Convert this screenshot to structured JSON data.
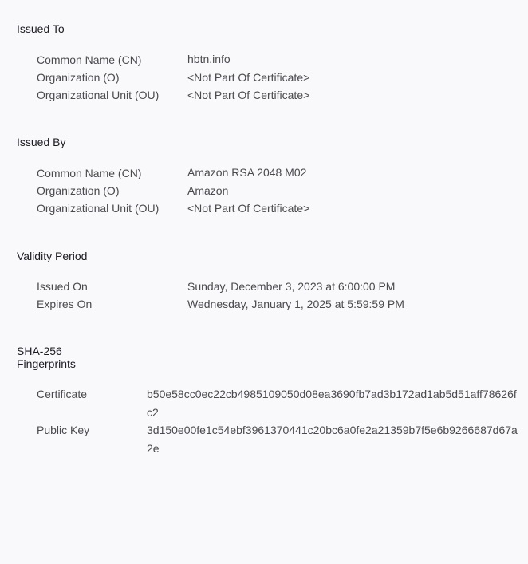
{
  "issued_to": {
    "heading": "Issued To",
    "rows": [
      {
        "label": "Common Name (CN)",
        "value": "hbtn.info"
      },
      {
        "label": "Organization (O)",
        "value": "<Not Part Of Certificate>"
      },
      {
        "label": "Organizational Unit (OU)",
        "value": "<Not Part Of Certificate>"
      }
    ]
  },
  "issued_by": {
    "heading": "Issued By",
    "rows": [
      {
        "label": "Common Name (CN)",
        "value": "Amazon RSA 2048 M02"
      },
      {
        "label": "Organization (O)",
        "value": "Amazon"
      },
      {
        "label": "Organizational Unit (OU)",
        "value": "<Not Part Of Certificate>"
      }
    ]
  },
  "validity": {
    "heading": "Validity Period",
    "rows": [
      {
        "label": "Issued On",
        "value": "Sunday, December 3, 2023 at 6:00:00 PM"
      },
      {
        "label": "Expires On",
        "value": "Wednesday, January 1, 2025 at 5:59:59 PM"
      }
    ]
  },
  "fingerprints": {
    "heading_line1": "SHA-256",
    "heading_line2": "Fingerprints",
    "rows": [
      {
        "label": "Certificate",
        "value": "b50e58cc0ec22cb4985109050d08ea3690fb7ad3b172ad1ab5d51aff78626fc2"
      },
      {
        "label": "Public Key",
        "value": "3d150e00fe1c54ebf3961370441c20bc6a0fe2a21359b7f5e6b9266687d67a2e"
      }
    ]
  }
}
